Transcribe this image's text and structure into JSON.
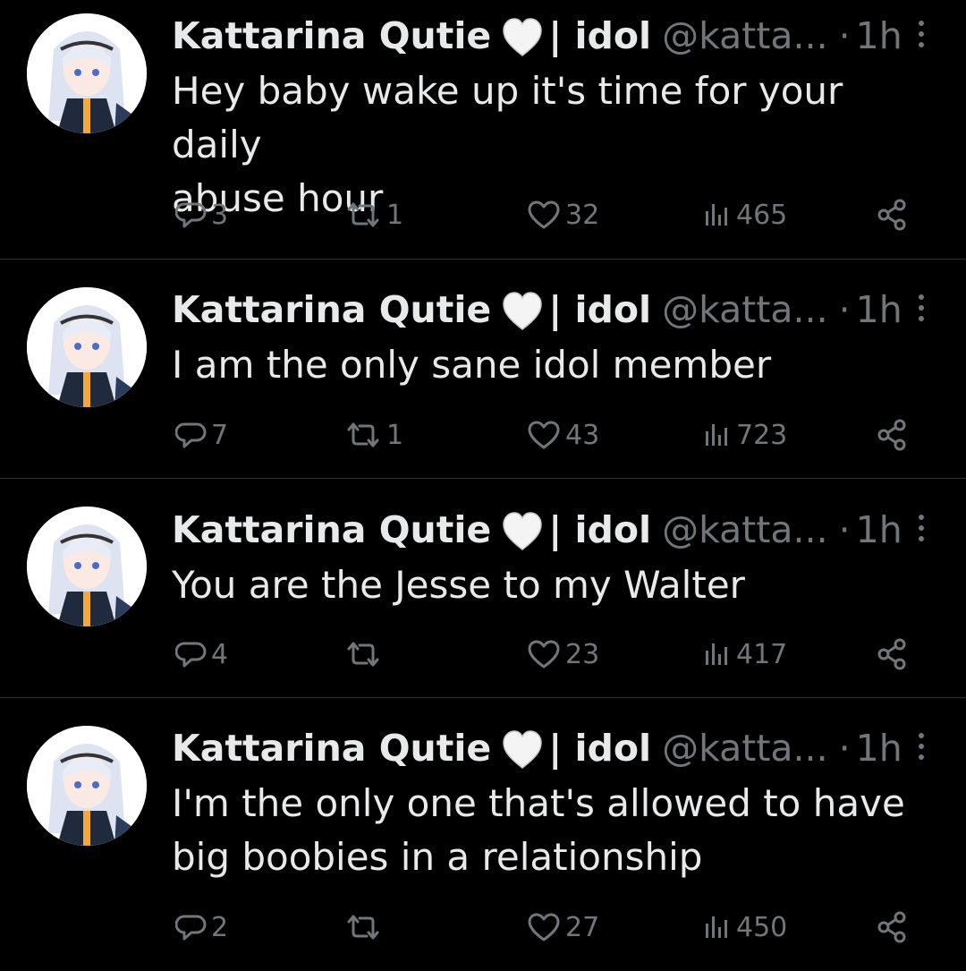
{
  "tweets": [
    {
      "name": "Kattarina Qutie",
      "separator": "| idol",
      "handle": "@katta...",
      "dot": "·",
      "time": "1h",
      "text_lines": [
        "Hey baby wake up it's time for your daily",
        "abuse hour"
      ],
      "replies": "3",
      "retweets": "1",
      "likes": "32",
      "views": "465"
    },
    {
      "name": "Kattarina Qutie",
      "separator": "| idol",
      "handle": "@katta...",
      "dot": "·",
      "time": "1h",
      "text_lines": [
        "I am the only sane idol member"
      ],
      "replies": "7",
      "retweets": "1",
      "likes": "43",
      "views": "723"
    },
    {
      "name": "Kattarina Qutie",
      "separator": "| idol",
      "handle": "@katta...",
      "dot": "·",
      "time": "1h",
      "text_lines": [
        "You are the Jesse to my Walter"
      ],
      "replies": "4",
      "retweets": "",
      "likes": "23",
      "views": "417"
    },
    {
      "name": "Kattarina Qutie",
      "separator": "| idol",
      "handle": "@katta...",
      "dot": "·",
      "time": "1h",
      "text_lines": [
        "I'm the only one that's allowed to have",
        "big boobies in a relationship"
      ],
      "replies": "2",
      "retweets": "",
      "likes": "27",
      "views": "450"
    }
  ],
  "icons": {
    "reply": "reply-icon",
    "retweet": "retweet-icon",
    "like": "heart-icon",
    "views": "views-icon",
    "share": "share-icon",
    "more": "more-vertical-icon",
    "name_emoji": "white-heart-emoji"
  },
  "colors": {
    "background": "#000000",
    "text": "#e7e9ea",
    "secondary": "#71767b",
    "divider": "#2f3336"
  }
}
